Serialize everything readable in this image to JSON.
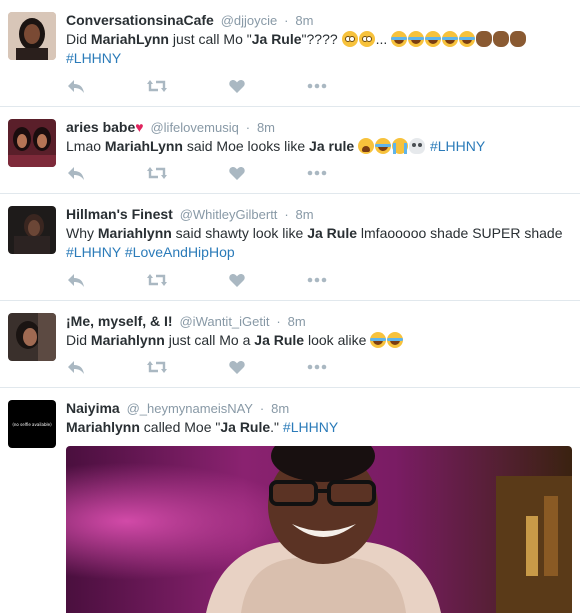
{
  "tweets": [
    {
      "name": "ConversationsinaCafe",
      "handle": "@djjoycie",
      "sep": "·",
      "time": "8m",
      "text": [
        {
          "t": "Did "
        },
        {
          "t": "MariahLynn",
          "b": true
        },
        {
          "t": " just call Mo \""
        },
        {
          "t": "Ja Rule",
          "b": true
        },
        {
          "t": "\"???? "
        },
        {
          "emoji": "flushed-face"
        },
        {
          "emoji": "flushed-face"
        },
        {
          "t": "... "
        },
        {
          "emoji": "tears-of-joy"
        },
        {
          "emoji": "tears-of-joy"
        },
        {
          "emoji": "tears-of-joy"
        },
        {
          "emoji": "tears-of-joy"
        },
        {
          "emoji": "tears-of-joy"
        },
        {
          "emoji": "clapping-hands"
        },
        {
          "emoji": "clapping-hands"
        },
        {
          "emoji": "clapping-hands"
        },
        {
          "br": true
        },
        {
          "t": "#LHHNY",
          "tag": true
        }
      ]
    },
    {
      "name": "aries babe",
      "name_heart": "♥",
      "handle": "@lifelovemusiq",
      "sep": "·",
      "time": "8m",
      "text": [
        {
          "t": "Lmao "
        },
        {
          "t": "MariahLynn",
          "b": true
        },
        {
          "t": " said Moe looks like "
        },
        {
          "t": "Ja rule",
          "b": true
        },
        {
          "t": " "
        },
        {
          "emoji": "tired-face"
        },
        {
          "emoji": "tears-of-joy"
        },
        {
          "emoji": "loudly-crying-face"
        },
        {
          "emoji": "skull"
        },
        {
          "t": " "
        },
        {
          "t": "#LHHNY",
          "tag": true
        }
      ]
    },
    {
      "name": "Hillman's Finest",
      "handle": "@WhitleyGilbertt",
      "sep": "·",
      "time": "8m",
      "text": [
        {
          "t": "Why "
        },
        {
          "t": "Mariahlynn",
          "b": true
        },
        {
          "t": " said shawty look like "
        },
        {
          "t": "Ja Rule",
          "b": true
        },
        {
          "t": " lmfaooooo shade SUPER shade"
        },
        {
          "br": true
        },
        {
          "t": "#LHHNY",
          "tag": true
        },
        {
          "t": " "
        },
        {
          "t": "#LoveAndHipHop",
          "tag": true
        }
      ]
    },
    {
      "name": "¡Me, myself, & I!",
      "handle": "@iWantit_iGetit",
      "sep": "·",
      "time": "8m",
      "text": [
        {
          "t": "Did "
        },
        {
          "t": "Mariahlynn",
          "b": true
        },
        {
          "t": " just call Mo a "
        },
        {
          "t": "Ja Rule",
          "b": true
        },
        {
          "t": " look alike "
        },
        {
          "emoji": "tears-of-joy"
        },
        {
          "emoji": "tears-of-joy"
        }
      ]
    },
    {
      "name": "Naiyima",
      "handle": "@_heymynameisNAY",
      "sep": "·",
      "time": "8m",
      "avatar_text": "(no selfie available)",
      "text": [
        {
          "t": "Mariahlynn",
          "b": true
        },
        {
          "t": " called Moe \""
        },
        {
          "t": "Ja Rule",
          "b": true
        },
        {
          "t": ".\" "
        },
        {
          "t": "#LHHNY",
          "tag": true
        }
      ]
    }
  ],
  "actions": {
    "reply_icon": "reply-icon",
    "retweet_icon": "retweet-icon",
    "like_icon": "heart-icon",
    "more_icon": "more-icon"
  },
  "colors": {
    "text": "#292f33",
    "muted": "#8899a6",
    "link": "#2b7bb9",
    "icon": "#aab8c2",
    "divider": "#e1e8ed",
    "heart": "#e0245e"
  }
}
